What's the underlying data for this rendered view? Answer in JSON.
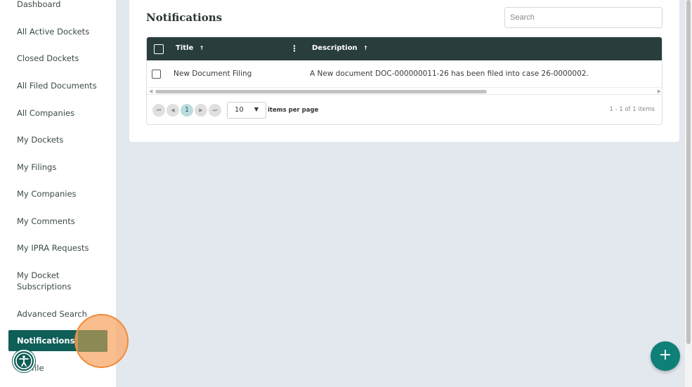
{
  "sidebar": {
    "items": [
      {
        "label": "Dashboard"
      },
      {
        "label": "All Active Dockets"
      },
      {
        "label": "Closed Dockets"
      },
      {
        "label": "All Filed Documents"
      },
      {
        "label": "All Companies"
      },
      {
        "label": "My Dockets"
      },
      {
        "label": "My Filings"
      },
      {
        "label": "My Companies"
      },
      {
        "label": "My Comments"
      },
      {
        "label": "My IPRA Requests"
      },
      {
        "label": "My Docket Subscriptions"
      },
      {
        "label": "Advanced Search"
      },
      {
        "label": "Notifications",
        "active": true
      },
      {
        "label": "Profile",
        "visible_text": "file"
      }
    ]
  },
  "main": {
    "title": "Notifications",
    "search": {
      "placeholder": "Search",
      "value": ""
    },
    "grid": {
      "columns": [
        {
          "label": "Title",
          "sort_icon": "arrow-up-icon"
        },
        {
          "label": "Description",
          "sort_icon": "arrow-up-icon"
        }
      ],
      "rows": [
        {
          "title": "New Document Filing",
          "description": "A New document DOC-000000011-26 has been filed into case 26-0000002."
        }
      ]
    },
    "pager": {
      "current_page": "1",
      "page_size": "10",
      "items_per_page_label": "items per page",
      "count_text": "1 - 1 of 1 items"
    }
  },
  "fab": {
    "label": "+"
  },
  "colors": {
    "accent": "#0f5e57",
    "header": "#283d3c",
    "fab": "#0f8078",
    "background": "#e3e7ee"
  }
}
